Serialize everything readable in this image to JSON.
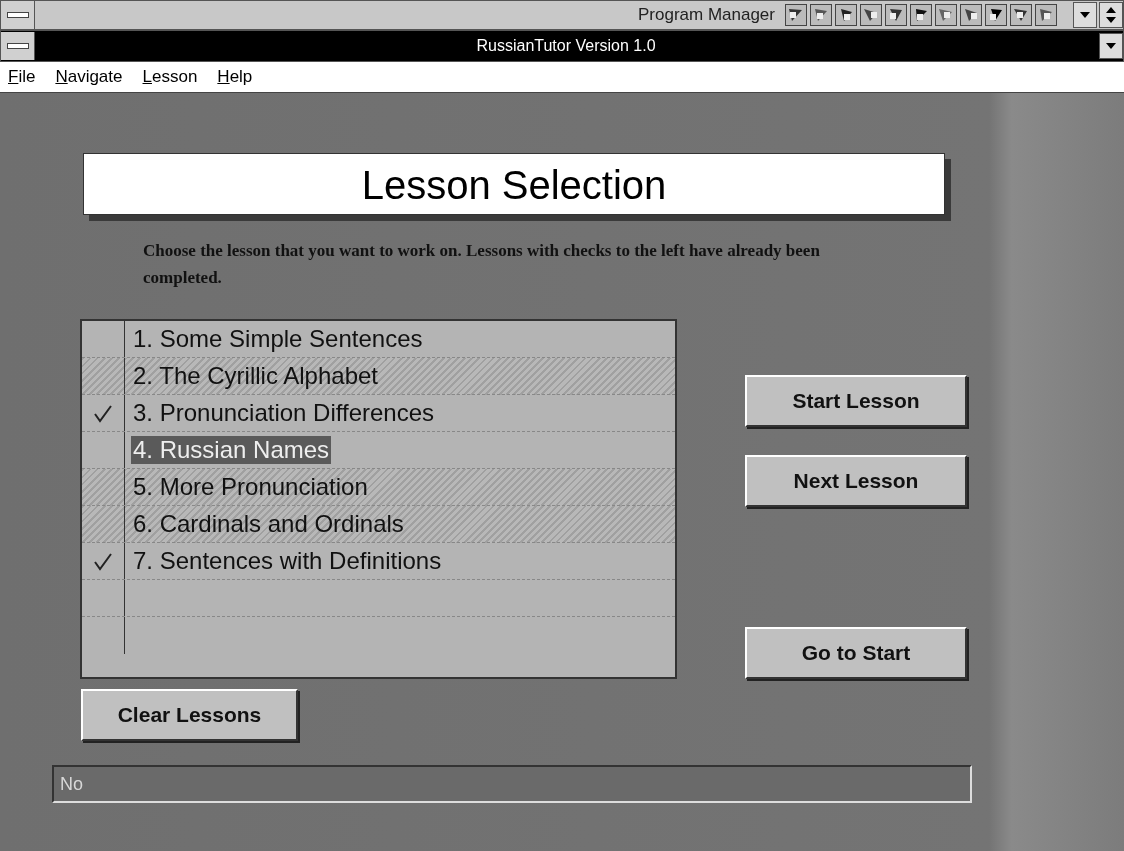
{
  "program_manager": {
    "title": "Program Manager"
  },
  "window": {
    "title": "RussianTutor Version 1.0"
  },
  "menu": [
    {
      "mnemonic": "F",
      "rest": "ile"
    },
    {
      "mnemonic": "N",
      "rest": "avigate"
    },
    {
      "mnemonic": "L",
      "rest": "esson"
    },
    {
      "mnemonic": "H",
      "rest": "elp"
    }
  ],
  "heading": "Lesson Selection",
  "instructions": "Choose the lesson that you want to work on.  Lessons with checks to the left have already been completed.",
  "lessons": [
    {
      "label": "1. Some Simple Sentences",
      "checked": false,
      "disabled": false,
      "selected": false
    },
    {
      "label": "2. The Cyrillic Alphabet",
      "checked": false,
      "disabled": true,
      "selected": false
    },
    {
      "label": "3. Pronunciation Differences",
      "checked": true,
      "disabled": false,
      "selected": false
    },
    {
      "label": "4. Russian Names",
      "checked": false,
      "disabled": false,
      "selected": true
    },
    {
      "label": "5. More Pronunciation",
      "checked": false,
      "disabled": true,
      "selected": false
    },
    {
      "label": "6. Cardinals and Ordinals",
      "checked": false,
      "disabled": true,
      "selected": false
    },
    {
      "label": "7. Sentences with Definitions",
      "checked": true,
      "disabled": false,
      "selected": false
    }
  ],
  "buttons": {
    "start": "Start Lesson",
    "next": "Next Lesson",
    "go_to_start": "Go to Start",
    "clear": "Clear Lessons"
  },
  "status": {
    "value": "No"
  }
}
